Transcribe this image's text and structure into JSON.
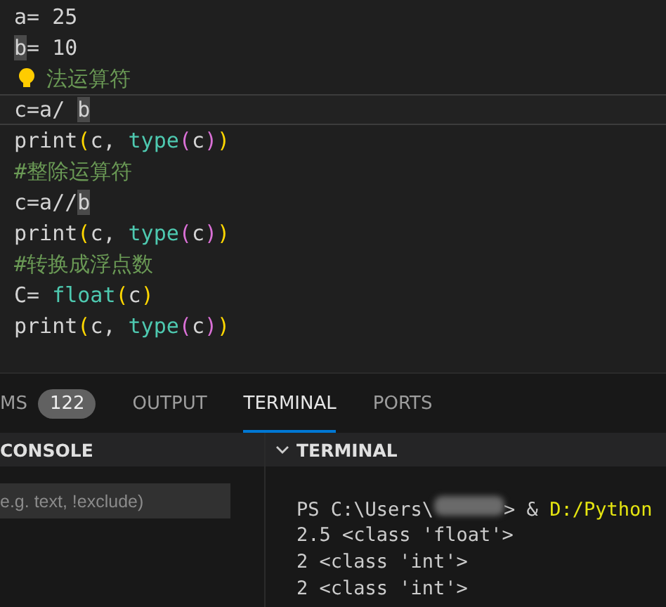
{
  "editor": {
    "lines": [
      {
        "current": false,
        "tokens": [
          {
            "kind": "plain",
            "text": "a= 25"
          }
        ]
      },
      {
        "current": false,
        "tokens": [
          {
            "kind": "match",
            "text": "b"
          },
          {
            "kind": "plain",
            "text": "= 10"
          }
        ]
      },
      {
        "current": false,
        "lightbulb": true,
        "tokens": [
          {
            "kind": "comment",
            "text": "法运算符"
          }
        ]
      },
      {
        "current": true,
        "tokens": [
          {
            "kind": "plain",
            "text": "c=a/ "
          },
          {
            "kind": "match",
            "text": "b"
          }
        ]
      },
      {
        "current": false,
        "tokens": [
          {
            "kind": "plain",
            "text": "print"
          },
          {
            "kind": "paren1",
            "text": "("
          },
          {
            "kind": "plain",
            "text": "c, "
          },
          {
            "kind": "builtin",
            "text": "type"
          },
          {
            "kind": "paren2",
            "text": "("
          },
          {
            "kind": "plain",
            "text": "c"
          },
          {
            "kind": "paren2",
            "text": ")"
          },
          {
            "kind": "paren1",
            "text": ")"
          }
        ]
      },
      {
        "current": false,
        "tokens": [
          {
            "kind": "comment",
            "text": "#整除运算符"
          }
        ]
      },
      {
        "current": false,
        "tokens": [
          {
            "kind": "plain",
            "text": "c=a//"
          },
          {
            "kind": "match",
            "text": "b"
          }
        ]
      },
      {
        "current": false,
        "tokens": [
          {
            "kind": "plain",
            "text": "print"
          },
          {
            "kind": "paren1",
            "text": "("
          },
          {
            "kind": "plain",
            "text": "c, "
          },
          {
            "kind": "builtin",
            "text": "type"
          },
          {
            "kind": "paren2",
            "text": "("
          },
          {
            "kind": "plain",
            "text": "c"
          },
          {
            "kind": "paren2",
            "text": ")"
          },
          {
            "kind": "paren1",
            "text": ")"
          }
        ]
      },
      {
        "current": false,
        "tokens": [
          {
            "kind": "comment",
            "text": "#转换成浮点数"
          }
        ]
      },
      {
        "current": false,
        "tokens": [
          {
            "kind": "plain",
            "text": "C= "
          },
          {
            "kind": "builtin",
            "text": "float"
          },
          {
            "kind": "paren1",
            "text": "("
          },
          {
            "kind": "plain",
            "text": "c"
          },
          {
            "kind": "paren1",
            "text": ")"
          }
        ]
      },
      {
        "current": false,
        "tokens": [
          {
            "kind": "plain",
            "text": "print"
          },
          {
            "kind": "paren1",
            "text": "("
          },
          {
            "kind": "plain",
            "text": "c, "
          },
          {
            "kind": "builtin",
            "text": "type"
          },
          {
            "kind": "paren2",
            "text": "("
          },
          {
            "kind": "plain",
            "text": "c"
          },
          {
            "kind": "paren2",
            "text": ")"
          },
          {
            "kind": "paren1",
            "text": ")"
          }
        ]
      }
    ]
  },
  "panel_tabs": [
    {
      "label": "MS",
      "badge": "122",
      "selected": false
    },
    {
      "label": "OUTPUT",
      "selected": false
    },
    {
      "label": "TERMINAL",
      "selected": true
    },
    {
      "label": "PORTS",
      "selected": false
    }
  ],
  "debug_console": {
    "title": "CONSOLE",
    "filter": {
      "placeholder": "e.g. text, !exclude)"
    }
  },
  "terminal": {
    "title": "TERMINAL",
    "expanded": true,
    "lines": [
      {
        "tokens": [
          {
            "kind": "plain",
            "text": "PS C:\\Users\\"
          },
          {
            "kind": "redacted"
          },
          {
            "kind": "plain",
            "text": "> & "
          },
          {
            "kind": "path",
            "text": "D:/Python"
          }
        ]
      },
      {
        "tokens": [
          {
            "kind": "plain",
            "text": "2.5 <class 'float'>"
          }
        ]
      },
      {
        "tokens": [
          {
            "kind": "plain",
            "text": "2 <class 'int'>"
          }
        ]
      },
      {
        "tokens": [
          {
            "kind": "plain",
            "text": "2 <class 'int'>"
          }
        ]
      }
    ]
  }
}
